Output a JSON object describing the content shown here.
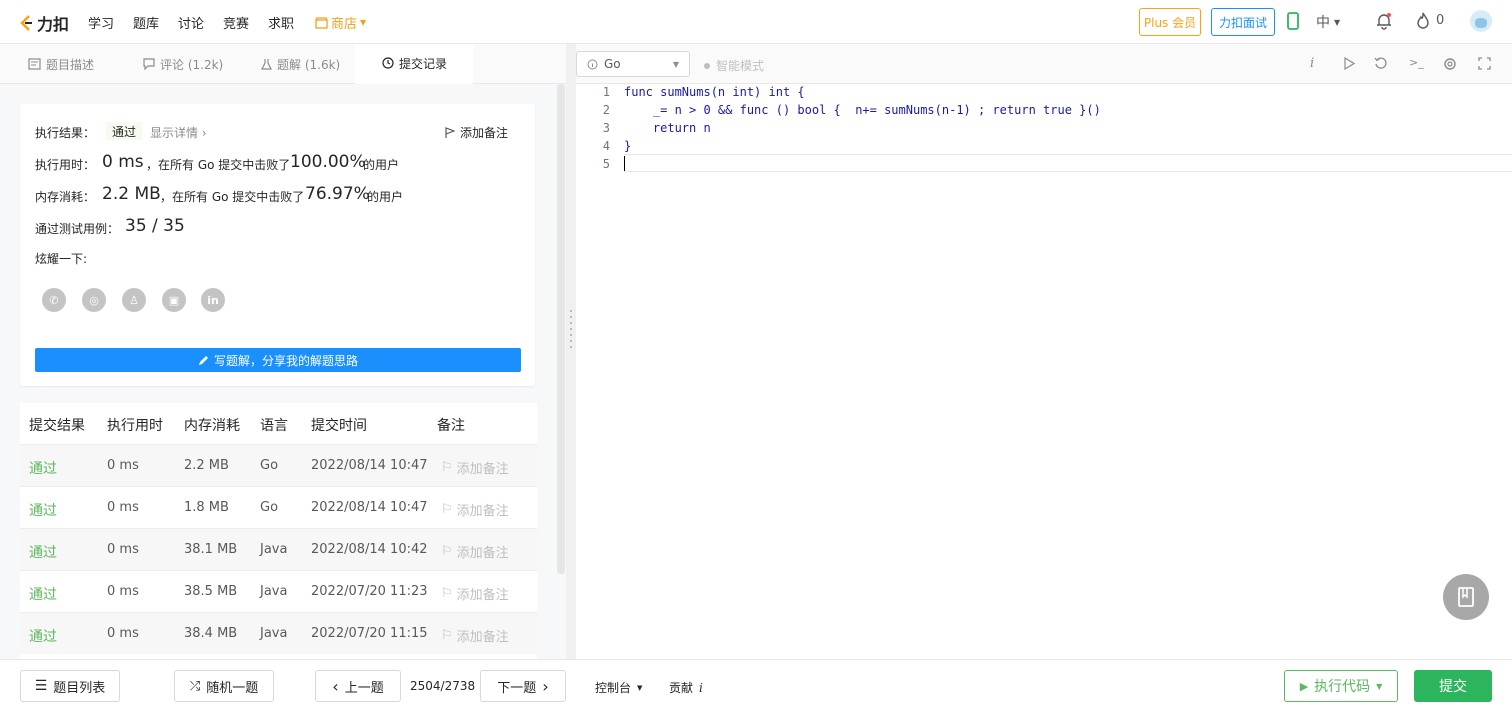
{
  "nav": {
    "logo_text": "力扣",
    "links": [
      "学习",
      "题库",
      "讨论",
      "竞赛",
      "求职"
    ],
    "store_label": "商店",
    "plus_label": "Plus 会员",
    "interview_label": "力扣面试",
    "lang_label": "中",
    "streak_count": "0"
  },
  "tabs": [
    {
      "label": "题目描述"
    },
    {
      "label": "评论 (1.2k)"
    },
    {
      "label": "题解 (1.6k)"
    },
    {
      "label": "提交记录"
    }
  ],
  "result": {
    "status_label": "执行结果：",
    "status_value": "通过",
    "detail_link": "显示详情 ›",
    "add_note": "添加备注",
    "time_label": "执行用时：",
    "time_value": "0 ms",
    "time_desc": "，在所有 Go 提交中击败了",
    "time_pct": "100.00%",
    "users_suffix": "的用户",
    "mem_label": "内存消耗：",
    "mem_value": "2.2 MB",
    "mem_desc": "，在所有 Go 提交中击败了",
    "mem_pct": "76.97%",
    "cases_label": "通过测试用例：",
    "cases_value": "35 / 35",
    "share_label": "炫耀一下:",
    "write_button": "写题解，分享我的解题思路"
  },
  "submissions": {
    "headers": [
      "提交结果",
      "执行用时",
      "内存消耗",
      "语言",
      "提交时间",
      "备注"
    ],
    "rows": [
      {
        "status": "通过",
        "time": "0 ms",
        "memory": "2.2 MB",
        "lang": "Go",
        "submitted": "2022/08/14 10:47",
        "note": "添加备注"
      },
      {
        "status": "通过",
        "time": "0 ms",
        "memory": "1.8 MB",
        "lang": "Go",
        "submitted": "2022/08/14 10:47",
        "note": "添加备注"
      },
      {
        "status": "通过",
        "time": "0 ms",
        "memory": "38.1 MB",
        "lang": "Java",
        "submitted": "2022/08/14 10:42",
        "note": "添加备注"
      },
      {
        "status": "通过",
        "time": "0 ms",
        "memory": "38.5 MB",
        "lang": "Java",
        "submitted": "2022/07/20 11:23",
        "note": "添加备注"
      },
      {
        "status": "通过",
        "time": "0 ms",
        "memory": "38.4 MB",
        "lang": "Java",
        "submitted": "2022/07/20 11:15",
        "note": "添加备注"
      }
    ]
  },
  "editor": {
    "language": "Go",
    "smart_mode": "智能模式",
    "line_numbers": [
      "1",
      "2",
      "3",
      "4",
      "5"
    ],
    "code_lines": [
      "func sumNums(n int) int {",
      "    _= n > 0 && func () bool {  n+= sumNums(n-1) ; return true }()",
      "    return n",
      "}",
      ""
    ]
  },
  "bottom": {
    "list_button": "题目列表",
    "random_button": "随机一题",
    "prev_button": "上一题",
    "progress": "2504/2738",
    "next_button": "下一题",
    "console_label": "控制台",
    "contribute_label": "贡献",
    "run_button": "执行代码",
    "submit_button": "提交"
  }
}
